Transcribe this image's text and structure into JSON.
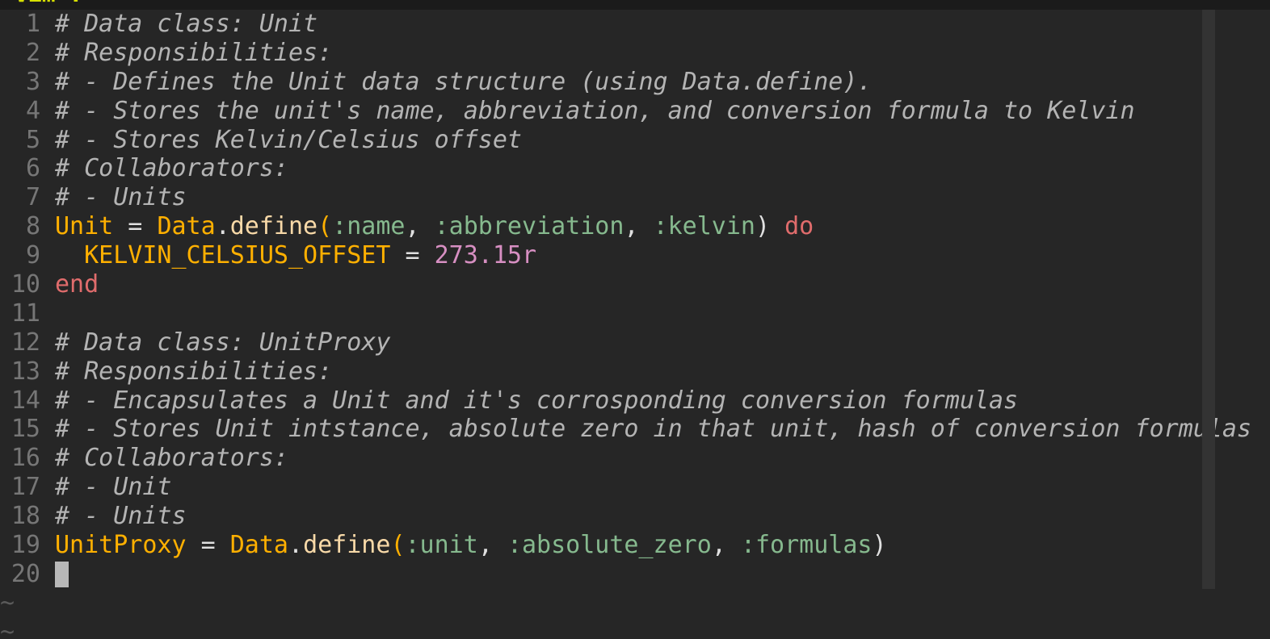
{
  "window": {
    "top_label": "Vim :"
  },
  "editor": {
    "lines": [
      {
        "n": "1",
        "tokens": [
          {
            "t": "# Data class: Unit",
            "c": "comment"
          }
        ]
      },
      {
        "n": "2",
        "tokens": [
          {
            "t": "# Responsibilities:",
            "c": "comment"
          }
        ]
      },
      {
        "n": "3",
        "tokens": [
          {
            "t": "# - Defines the Unit data structure (using Data.define).",
            "c": "comment"
          }
        ]
      },
      {
        "n": "4",
        "tokens": [
          {
            "t": "# - Stores the unit's name, abbreviation, and conversion formula to Kelvin",
            "c": "comment"
          }
        ]
      },
      {
        "n": "5",
        "tokens": [
          {
            "t": "# - Stores Kelvin/Celsius offset",
            "c": "comment"
          }
        ]
      },
      {
        "n": "6",
        "tokens": [
          {
            "t": "# Collaborators:",
            "c": "comment"
          }
        ]
      },
      {
        "n": "7",
        "tokens": [
          {
            "t": "# - Units",
            "c": "comment"
          }
        ]
      },
      {
        "n": "8",
        "tokens": [
          {
            "t": "Unit",
            "c": "const"
          },
          {
            "t": " = ",
            "c": "punct"
          },
          {
            "t": "Data",
            "c": "const"
          },
          {
            "t": ".",
            "c": "punct"
          },
          {
            "t": "define",
            "c": "method"
          },
          {
            "t": "(",
            "c": "const"
          },
          {
            "t": ":name",
            "c": "sym"
          },
          {
            "t": ", ",
            "c": "punct"
          },
          {
            "t": ":abbreviation",
            "c": "sym"
          },
          {
            "t": ", ",
            "c": "punct"
          },
          {
            "t": ":kelvin",
            "c": "sym"
          },
          {
            "t": ") ",
            "c": "punct"
          },
          {
            "t": "do",
            "c": "kw"
          }
        ]
      },
      {
        "n": "9",
        "tokens": [
          {
            "t": "  ",
            "c": "punct"
          },
          {
            "t": "KELVIN_CELSIUS_OFFSET",
            "c": "const"
          },
          {
            "t": " = ",
            "c": "punct"
          },
          {
            "t": "273.15r",
            "c": "num"
          }
        ]
      },
      {
        "n": "10",
        "tokens": [
          {
            "t": "end",
            "c": "kw"
          }
        ]
      },
      {
        "n": "11",
        "tokens": []
      },
      {
        "n": "12",
        "tokens": [
          {
            "t": "# Data class: UnitProxy",
            "c": "comment"
          }
        ]
      },
      {
        "n": "13",
        "tokens": [
          {
            "t": "# Responsibilities:",
            "c": "comment"
          }
        ]
      },
      {
        "n": "14",
        "tokens": [
          {
            "t": "# - Encapsulates a Unit and it's corrosponding conversion formulas",
            "c": "comment"
          }
        ]
      },
      {
        "n": "15",
        "tokens": [
          {
            "t": "# - Stores Unit intstance, absolute zero in that unit, hash of conversion formulas",
            "c": "comment"
          }
        ]
      },
      {
        "n": "16",
        "tokens": [
          {
            "t": "# Collaborators:",
            "c": "comment"
          }
        ]
      },
      {
        "n": "17",
        "tokens": [
          {
            "t": "# - Unit",
            "c": "comment"
          }
        ]
      },
      {
        "n": "18",
        "tokens": [
          {
            "t": "# - Units",
            "c": "comment"
          }
        ]
      },
      {
        "n": "19",
        "tokens": [
          {
            "t": "UnitProxy",
            "c": "const"
          },
          {
            "t": " = ",
            "c": "punct"
          },
          {
            "t": "Data",
            "c": "const"
          },
          {
            "t": ".",
            "c": "punct"
          },
          {
            "t": "define",
            "c": "method"
          },
          {
            "t": "(",
            "c": "const"
          },
          {
            "t": ":unit",
            "c": "sym"
          },
          {
            "t": ", ",
            "c": "punct"
          },
          {
            "t": ":absolute_zero",
            "c": "sym"
          },
          {
            "t": ", ",
            "c": "punct"
          },
          {
            "t": ":formulas",
            "c": "sym"
          },
          {
            "t": ")",
            "c": "punct"
          }
        ]
      },
      {
        "n": "20",
        "tokens": [],
        "cursor": true
      }
    ],
    "empty_markers": [
      "~",
      "~"
    ]
  },
  "colors": {
    "background": "#262626",
    "comment": "#b4b4b4",
    "constant": "#ffb000",
    "symbol": "#86b98e",
    "keyword": "#e06c6c",
    "number": "#d78fc2",
    "line_number": "#767676"
  }
}
